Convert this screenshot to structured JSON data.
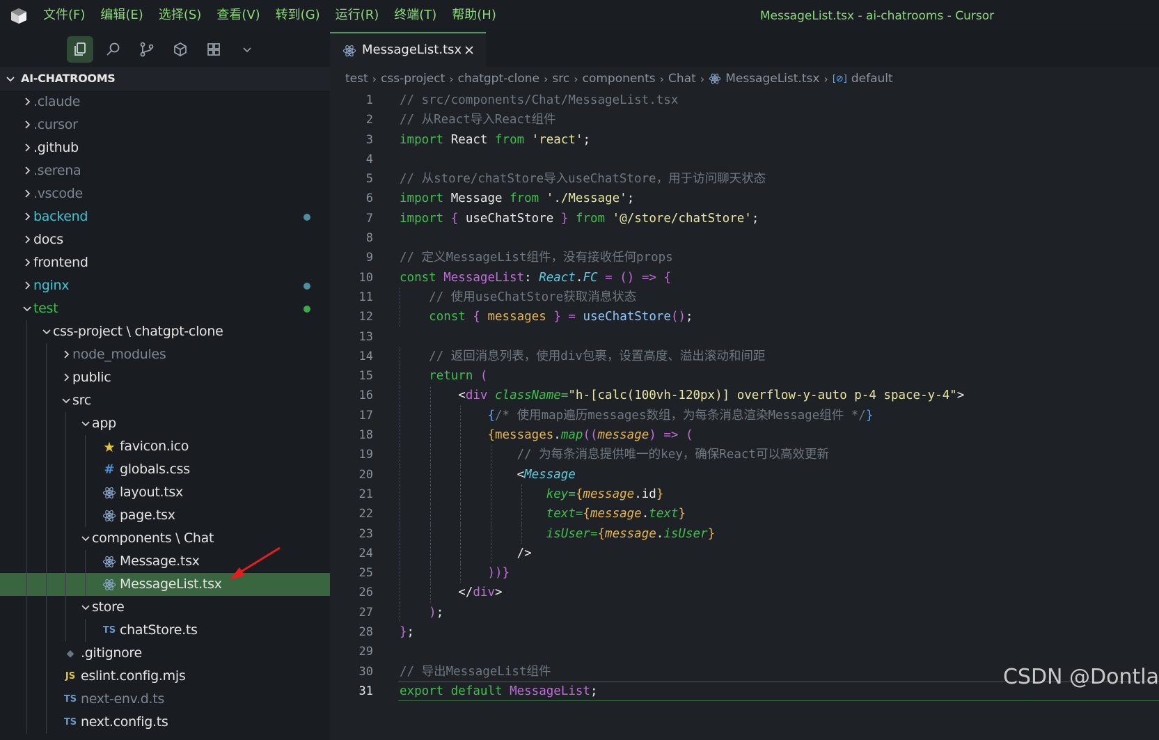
{
  "titlebar": {
    "menus": [
      "文件(F)",
      "编辑(E)",
      "选择(S)",
      "查看(V)",
      "转到(G)",
      "运行(R)",
      "终端(T)",
      "帮助(H)"
    ],
    "window_title": "MessageList.tsx - ai-chatrooms - Cursor"
  },
  "sidebar": {
    "activity_icons": [
      "files-icon",
      "search-icon",
      "source-control-icon",
      "cube-icon",
      "extensions-icon",
      "chevron-down-icon"
    ],
    "explorer_title": "AI-CHATROOMS",
    "tree": [
      {
        "label": ".claude",
        "depth": 0,
        "type": "folder",
        "state": "collapsed",
        "style": "dim"
      },
      {
        "label": ".cursor",
        "depth": 0,
        "type": "folder",
        "state": "collapsed",
        "style": "dim"
      },
      {
        "label": ".github",
        "depth": 0,
        "type": "folder",
        "state": "collapsed",
        "style": "normal"
      },
      {
        "label": ".serena",
        "depth": 0,
        "type": "folder",
        "state": "collapsed",
        "style": "dim"
      },
      {
        "label": ".vscode",
        "depth": 0,
        "type": "folder",
        "state": "collapsed",
        "style": "dim"
      },
      {
        "label": "backend",
        "depth": 0,
        "type": "folder",
        "state": "collapsed",
        "style": "teal",
        "dot": "#4e8ea0"
      },
      {
        "label": "docs",
        "depth": 0,
        "type": "folder",
        "state": "collapsed",
        "style": "normal"
      },
      {
        "label": "frontend",
        "depth": 0,
        "type": "folder",
        "state": "collapsed",
        "style": "normal"
      },
      {
        "label": "nginx",
        "depth": 0,
        "type": "folder",
        "state": "collapsed",
        "style": "teal",
        "dot": "#4e8ea0"
      },
      {
        "label": "test",
        "depth": 0,
        "type": "folder",
        "state": "expanded",
        "style": "green",
        "dot": "#3fa84a"
      },
      {
        "label": "css-project \\ chatgpt-clone",
        "depth": 1,
        "type": "folder",
        "state": "expanded",
        "style": "normal"
      },
      {
        "label": "node_modules",
        "depth": 2,
        "type": "folder",
        "state": "collapsed",
        "style": "dim"
      },
      {
        "label": "public",
        "depth": 2,
        "type": "folder",
        "state": "collapsed",
        "style": "normal"
      },
      {
        "label": "src",
        "depth": 2,
        "type": "folder",
        "state": "expanded",
        "style": "normal"
      },
      {
        "label": "app",
        "depth": 3,
        "type": "folder",
        "state": "expanded",
        "style": "normal"
      },
      {
        "label": "favicon.ico",
        "depth": 4,
        "type": "file",
        "icon": "star-icon",
        "style": "normal"
      },
      {
        "label": "globals.css",
        "depth": 4,
        "type": "file",
        "icon": "css-icon",
        "style": "normal"
      },
      {
        "label": "layout.tsx",
        "depth": 4,
        "type": "file",
        "icon": "react-icon",
        "style": "normal"
      },
      {
        "label": "page.tsx",
        "depth": 4,
        "type": "file",
        "icon": "react-icon",
        "style": "normal"
      },
      {
        "label": "components \\ Chat",
        "depth": 3,
        "type": "folder",
        "state": "expanded",
        "style": "normal"
      },
      {
        "label": "Message.tsx",
        "depth": 4,
        "type": "file",
        "icon": "react-icon",
        "style": "normal"
      },
      {
        "label": "MessageList.tsx",
        "depth": 4,
        "type": "file",
        "icon": "react-icon",
        "style": "normal",
        "selected": true
      },
      {
        "label": "store",
        "depth": 3,
        "type": "folder",
        "state": "expanded",
        "style": "normal"
      },
      {
        "label": "chatStore.ts",
        "depth": 4,
        "type": "file",
        "icon": "ts-icon",
        "style": "normal"
      },
      {
        "label": ".gitignore",
        "depth": 2,
        "type": "file",
        "icon": "git-icon",
        "style": "normal"
      },
      {
        "label": "eslint.config.mjs",
        "depth": 2,
        "type": "file",
        "icon": "js-icon",
        "style": "normal"
      },
      {
        "label": "next-env.d.ts",
        "depth": 2,
        "type": "file",
        "icon": "ts-icon",
        "style": "dim"
      },
      {
        "label": "next.config.ts",
        "depth": 2,
        "type": "file",
        "icon": "ts-icon",
        "style": "normal"
      }
    ]
  },
  "editor": {
    "tab_label": "MessageList.tsx",
    "breadcrumb": [
      "test",
      "css-project",
      "chatgpt-clone",
      "src",
      "components",
      "Chat",
      "MessageList.tsx",
      "default"
    ],
    "current_line": 31,
    "lines": [
      "// src/components/Chat/MessageList.tsx",
      "// 从React导入React组件",
      "import React from 'react';",
      "",
      "// 从store/chatStore导入useChatStore，用于访问聊天状态",
      "import Message from './Message';",
      "import { useChatStore } from '@/store/chatStore';",
      "",
      "// 定义MessageList组件，没有接收任何props",
      "const MessageList: React.FC = () => {",
      "  // 使用useChatStore获取消息状态",
      "  const { messages } = useChatStore();",
      "",
      "  // 返回消息列表，使用div包裹，设置高度、溢出滚动和间距",
      "  return (",
      "    <div className=\"h-[calc(100vh-120px)] overflow-y-auto p-4 space-y-4\">",
      "      {/* 使用map遍历messages数组，为每条消息渲染Message组件 */}",
      "      {messages.map((message) => (",
      "        // 为每条消息提供唯一的key，确保React可以高效更新",
      "        <Message",
      "          key={message.id}",
      "          text={message.text}",
      "          isUser={message.isUser}",
      "        />",
      "      ))}",
      "    </div>",
      "  );",
      "};",
      "",
      "// 导出MessageList组件",
      "export default MessageList;"
    ]
  },
  "watermark": "CSDN @Dontla",
  "colors": {
    "accent": "#8cd97a",
    "selection": "#39663f",
    "keyword": "#3fbf4a"
  }
}
